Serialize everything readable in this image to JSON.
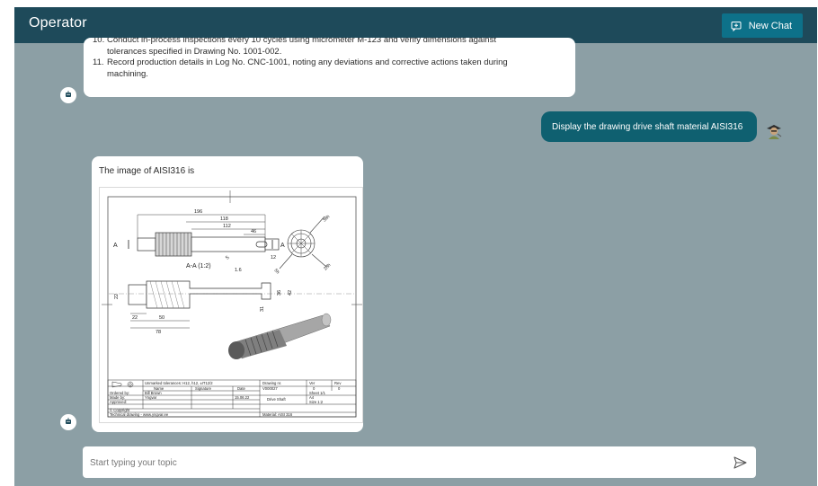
{
  "app": {
    "title": "Operator",
    "new_chat_label": "New Chat",
    "icon_new_chat": "chat-plus-icon"
  },
  "messages": {
    "bot1": {
      "lines": [
        {
          "num": "10.",
          "text": "Conduct in-process inspections every 10 cycles using micrometer M-123 and verify dimensions against"
        },
        {
          "num": "",
          "text": "tolerances specified in Drawing No. 1001-002."
        },
        {
          "num": "11.",
          "text": "Record production details in Log No. CNC-1001, noting any deviations and corrective actions taken during"
        },
        {
          "num": "",
          "text": "machining."
        }
      ]
    },
    "user1": {
      "text": "Display the drawing drive shaft material AISI316"
    },
    "bot2": {
      "text": "The image of AISI316 is"
    }
  },
  "drawing": {
    "dims": {
      "d196": "196",
      "d118": "118",
      "d112": "112",
      "d46": "46",
      "d12": "12",
      "d5": "5",
      "d1_6": "1.6",
      "d22": "22",
      "d50": "50",
      "d78": "78",
      "d36": "36",
      "d42": "42",
      "d31": "31",
      "dsm": "R5"
    },
    "section_label": "A-A (1:2)",
    "section_mark": "A",
    "title_block": {
      "tolerances": "Unmarked tolerances: H12, h12, ±IT12/2",
      "drawing_nr_label": "Drawing nr.",
      "drawing_nr": "V000027",
      "ver_label": "Ver",
      "ver": "0",
      "rev_label": "Rev",
      "rev": "0",
      "name_label": "Name",
      "signature_label": "Signature",
      "date_label": "Date",
      "ordered_by_label": "Ordered by:",
      "ordered_by": "Bill Brown",
      "date": "15.06.22",
      "made_by_label": "Made by:",
      "made_by": "Yngvar",
      "approved_label": "Approved:",
      "part_name": "Drive Shaft",
      "sheet": "Sheet 1/1",
      "format": "A4",
      "size": "Size   1:2",
      "copyright": "© Copyright",
      "website": "Technical drawing - www.yngvar.ee",
      "material": "Material:  AISI 316"
    }
  },
  "composer": {
    "placeholder": "Start typing your topic",
    "icon_send": "send-icon"
  },
  "colors": {
    "topbar": "#1e4a5a",
    "accent": "#0d7189",
    "user_bubble": "#0f6070",
    "background": "#8c9fa5"
  }
}
